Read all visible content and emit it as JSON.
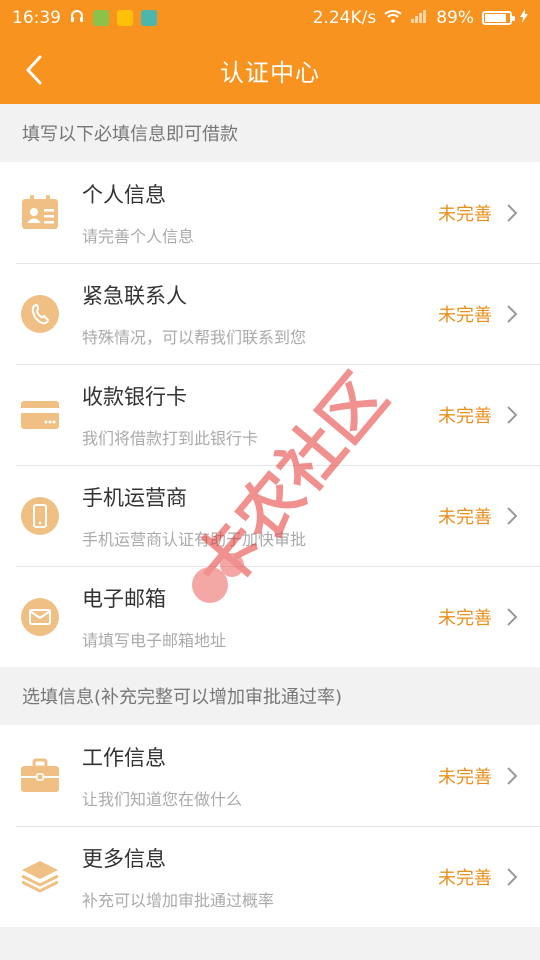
{
  "status_bar": {
    "time": "16:39",
    "speed": "2.24K/s",
    "battery": "89%",
    "battery_level": 0.89
  },
  "nav": {
    "title": "认证中心",
    "back_icon": "chevron-left-icon"
  },
  "required_section": {
    "header": "填写以下必填信息即可借款",
    "items": [
      {
        "title": "个人信息",
        "subtitle": "请完善个人信息",
        "status": "未完善",
        "icon": "id-card-icon"
      },
      {
        "title": "紧急联系人",
        "subtitle": "特殊情况，可以帮我们联系到您",
        "status": "未完善",
        "icon": "phone-handset-icon"
      },
      {
        "title": "收款银行卡",
        "subtitle": "我们将借款打到此银行卡",
        "status": "未完善",
        "icon": "bank-card-icon"
      },
      {
        "title": "手机运营商",
        "subtitle": "手机运营商认证有助于加快审批",
        "status": "未完善",
        "icon": "mobile-phone-icon"
      },
      {
        "title": "电子邮箱",
        "subtitle": "请填写电子邮箱地址",
        "status": "未完善",
        "icon": "mail-icon"
      }
    ]
  },
  "optional_section": {
    "header": "选填信息(补充完整可以增加审批通过率)",
    "items": [
      {
        "title": "工作信息",
        "subtitle": "让我们知道您在做什么",
        "status": "未完善",
        "icon": "briefcase-icon"
      },
      {
        "title": "更多信息",
        "subtitle": "补充可以增加审批通过概率",
        "status": "未完善",
        "icon": "layers-icon"
      }
    ]
  },
  "colors": {
    "accent": "#f7931e",
    "status_text": "#e8901f",
    "icon": "#f0bf84",
    "watermark": "#e53935"
  },
  "watermark": {
    "text": "卡农社区"
  }
}
